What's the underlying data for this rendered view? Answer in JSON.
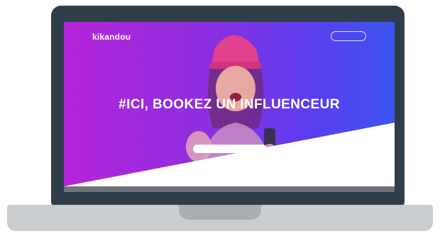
{
  "app": {
    "logo": "kikandou",
    "nav_button_label": "",
    "headline": "#ICI, BOOKEZ UN INFLUENCEUR",
    "subtitle": "",
    "cta_label": ""
  },
  "colors": {
    "lid": "#2f3d4a",
    "base": "#c9cdd0",
    "gradient_start": "#b624d9",
    "gradient_end": "#3b55f2",
    "hat": "#e2418f",
    "white": "#ffffff"
  },
  "icons": {
    "hero": "person-in-pink-beanie-photo"
  }
}
